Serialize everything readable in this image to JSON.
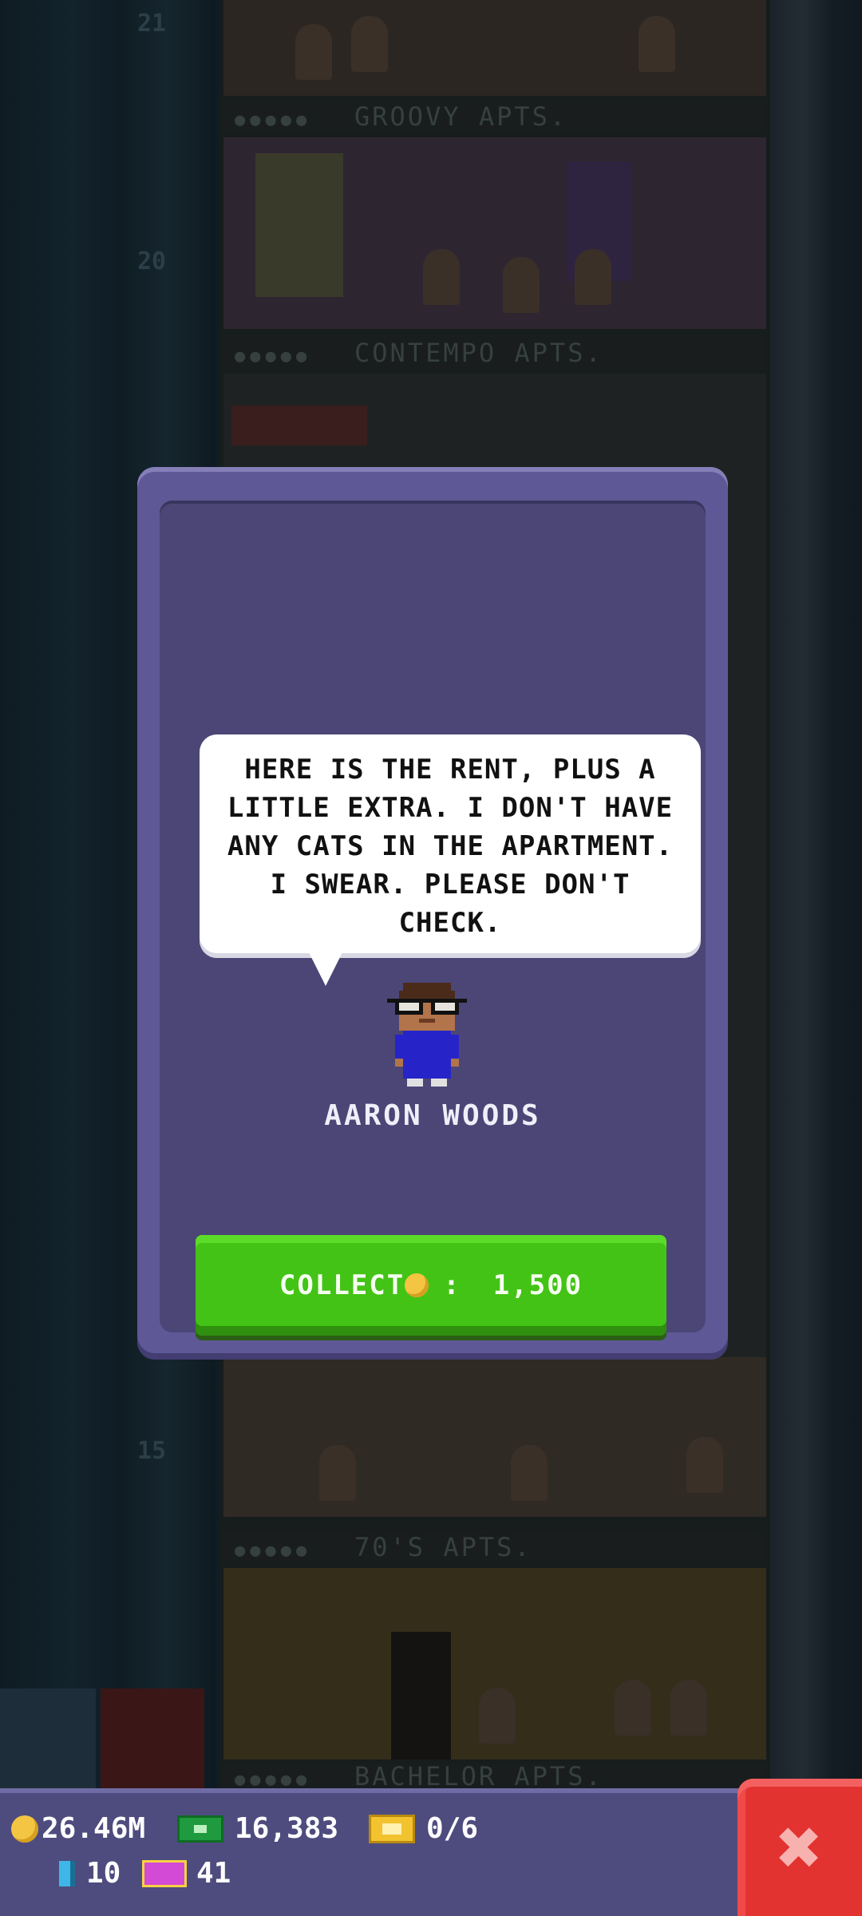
{
  "background": {
    "floor_numbers": [
      "21",
      "20",
      "15"
    ],
    "floor_labels": [
      "GROOVY APTS.",
      "CONTEMPO APTS.",
      "70'S APTS.",
      "BACHELOR APTS."
    ]
  },
  "dialog": {
    "speech": "HERE IS THE RENT, PLUS A LITTLE EXTRA. I DON'T HAVE ANY CATS IN THE APARTMENT. I SWEAR. PLEASE DON'T CHECK.",
    "resident_name": "AARON WOODS",
    "collect_button": {
      "label": "COLLECT",
      "separator": ":",
      "amount": "1,500",
      "icon": "coin-icon"
    }
  },
  "hud": {
    "coins": "26.46M",
    "cash": "16,383",
    "tickets": "0/6",
    "bux": "10",
    "vip": "41",
    "close_icon": "close-x-icon"
  },
  "colors": {
    "dialog_frame": "#5f5896",
    "dialog_panel": "#4b4676",
    "collect_green": "#43c316",
    "close_red": "#e23331",
    "hud_bar": "#4e4c7e",
    "coin_gold": "#f4c542"
  }
}
